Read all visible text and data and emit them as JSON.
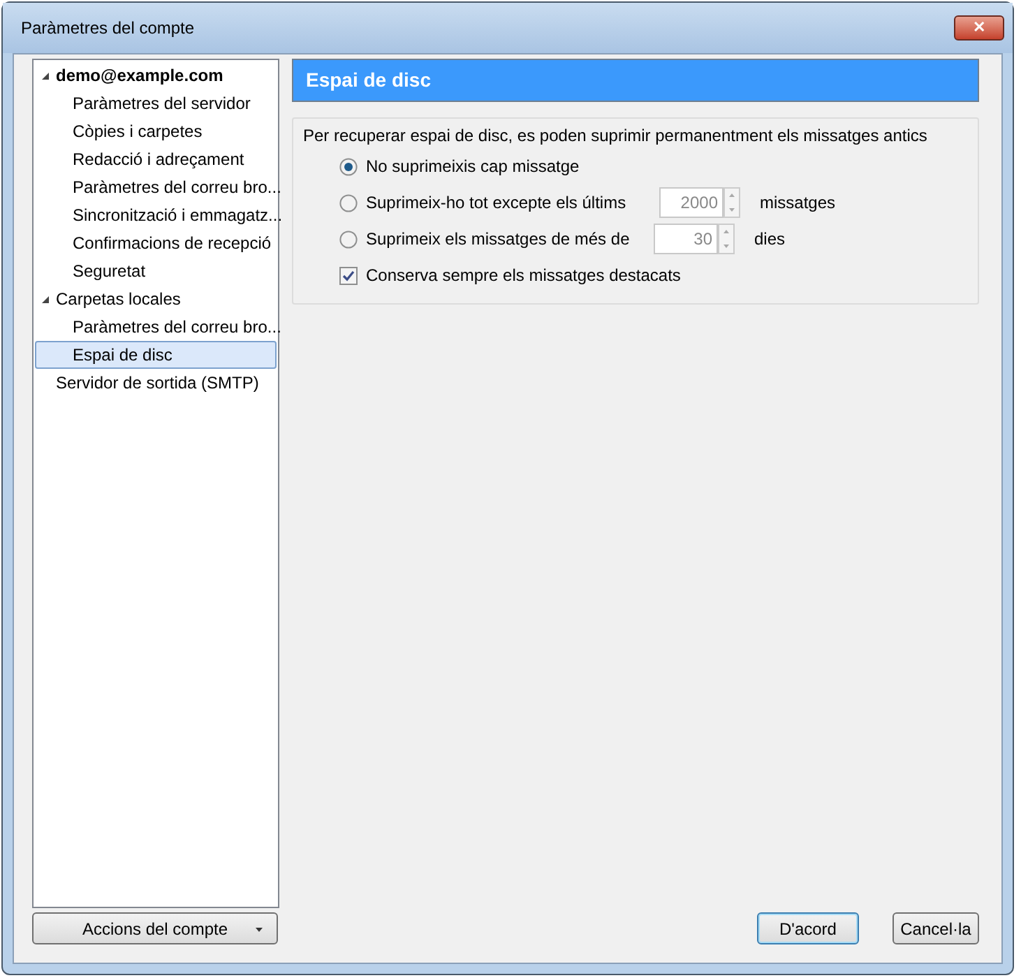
{
  "window": {
    "title": "Paràmetres del compte",
    "close_label": "✕"
  },
  "tree": [
    {
      "label": "demo@example.com",
      "default": true,
      "selected": false,
      "expanded": true,
      "children": [
        {
          "label": "Paràmetres del servidor",
          "selected": false
        },
        {
          "label": "Còpies i carpetes",
          "selected": false
        },
        {
          "label": "Redacció i adreçament",
          "selected": false
        },
        {
          "label": "Paràmetres del correu bro...",
          "selected": false
        },
        {
          "label": "Sincronització i emmagatz...",
          "selected": false
        },
        {
          "label": "Confirmacions de recepció",
          "selected": false
        },
        {
          "label": "Seguretat",
          "selected": false
        }
      ]
    },
    {
      "label": "Carpetas locales",
      "default": false,
      "selected": false,
      "expanded": true,
      "children": [
        {
          "label": "Paràmetres del correu bro...",
          "selected": false
        },
        {
          "label": "Espai de disc",
          "selected": true
        }
      ]
    },
    {
      "label": "Servidor de sortida (SMTP)",
      "default": false,
      "selected": false
    }
  ],
  "account_actions": {
    "label": "Accions del compte"
  },
  "panel": {
    "title": "Espai de disc",
    "description": "Per recuperar espai de disc, es poden suprimir permanentment els missatges antics",
    "options": [
      {
        "kind": "radio",
        "label": "No suprimeixis cap missatge",
        "selected": true
      },
      {
        "kind": "radio",
        "label": "Suprimeix-ho tot excepte els últims",
        "selected": false,
        "value": "2000",
        "unit": "missatges"
      },
      {
        "kind": "radio",
        "label": "Suprimeix els missatges de més de",
        "selected": false,
        "value": "30",
        "unit": "dies"
      },
      {
        "kind": "checkbox",
        "label": "Conserva sempre els missatges destacats",
        "checked": true
      }
    ]
  },
  "buttons": [
    {
      "label": "D'acord",
      "default": true
    },
    {
      "label": "Cancel·la",
      "default": false
    }
  ]
}
